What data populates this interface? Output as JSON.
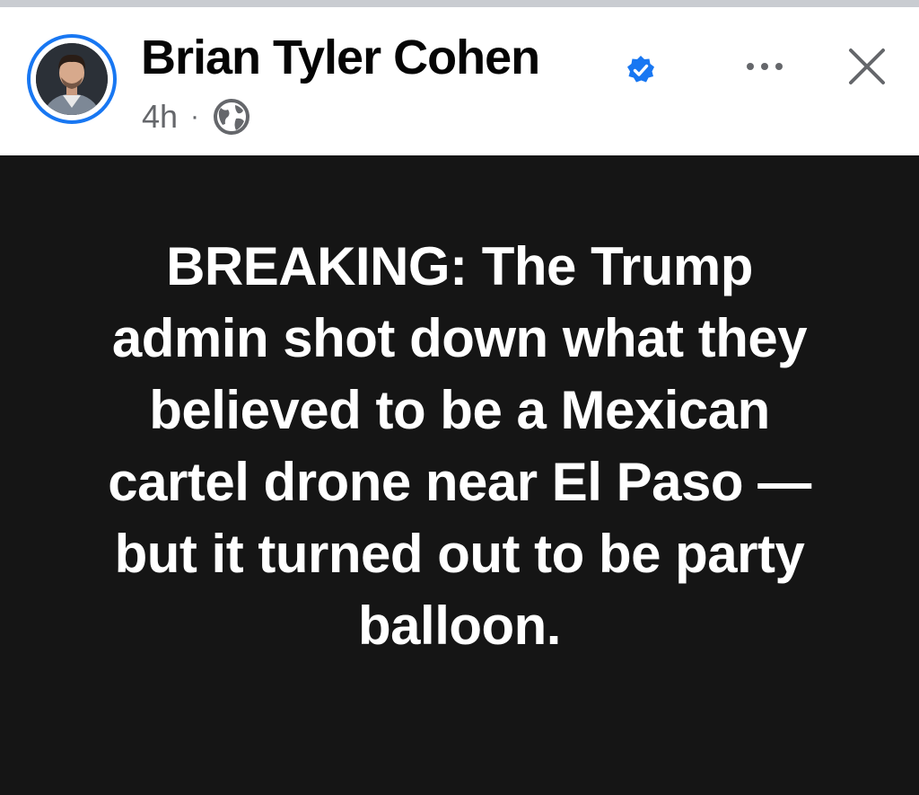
{
  "post": {
    "author": {
      "name": "Brian Tyler Cohen",
      "verified": true
    },
    "timestamp": "4h",
    "separator": "·",
    "privacy_icon": "globe-icon",
    "actions": {
      "more_icon": "more-options-icon",
      "close_icon": "close-icon"
    },
    "body": {
      "text": "BREAKING: The Trump admin shot down what they believed to be a Mexican cartel drone near El Paso — but it turned out to be party balloon.",
      "background_color": "#151515",
      "text_color": "#ffffff"
    }
  },
  "colors": {
    "accent": "#1877f2",
    "secondary_text": "#65676b",
    "primary_text": "#050505"
  }
}
